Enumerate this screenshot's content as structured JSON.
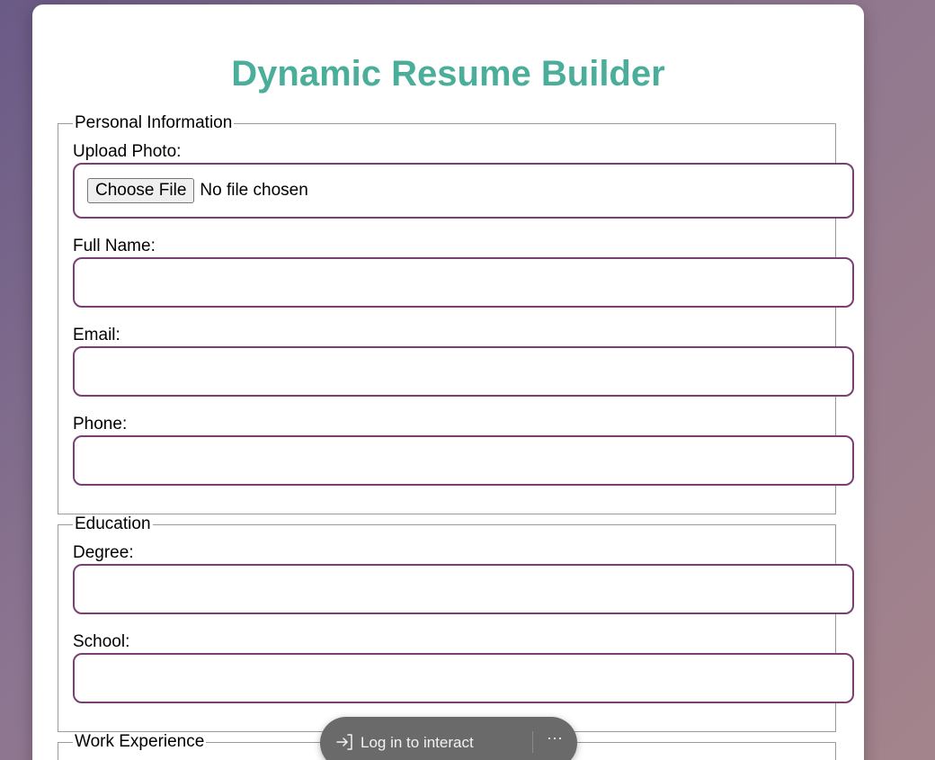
{
  "page": {
    "title": "Dynamic Resume Builder"
  },
  "sections": {
    "personal": {
      "legend": "Personal Information",
      "photo_label": "Upload Photo:",
      "choose_file_label": "Choose File",
      "file_status": "No file chosen",
      "full_name_label": "Full Name:",
      "full_name_value": "",
      "email_label": "Email:",
      "email_value": "",
      "phone_label": "Phone:",
      "phone_value": ""
    },
    "education": {
      "legend": "Education",
      "degree_label": "Degree:",
      "degree_value": "",
      "school_label": "School:",
      "school_value": ""
    },
    "work": {
      "legend": "Work Experience"
    }
  },
  "overlay": {
    "login_label": "Log in to interact",
    "login_icon": "login-arrow-icon",
    "more_icon": "more-horizontal-icon",
    "more_glyph": "···"
  },
  "colors": {
    "title": "#4aae9b",
    "input_border": "#7a3f73",
    "pill_bg": "#6a6a6a"
  }
}
